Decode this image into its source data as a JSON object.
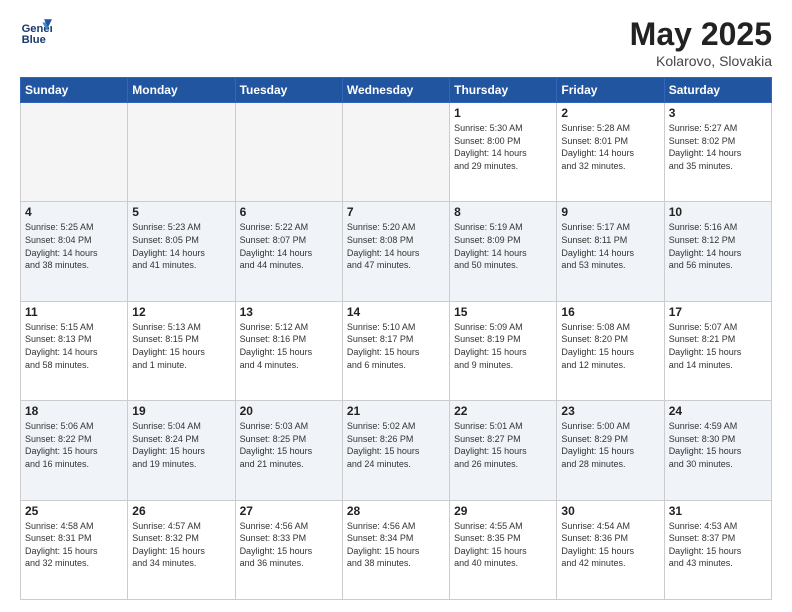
{
  "header": {
    "logo_line1": "General",
    "logo_line2": "Blue",
    "month_year": "May 2025",
    "location": "Kolarovo, Slovakia"
  },
  "weekdays": [
    "Sunday",
    "Monday",
    "Tuesday",
    "Wednesday",
    "Thursday",
    "Friday",
    "Saturday"
  ],
  "weeks": [
    [
      {
        "day": "",
        "info": ""
      },
      {
        "day": "",
        "info": ""
      },
      {
        "day": "",
        "info": ""
      },
      {
        "day": "",
        "info": ""
      },
      {
        "day": "1",
        "info": "Sunrise: 5:30 AM\nSunset: 8:00 PM\nDaylight: 14 hours\nand 29 minutes."
      },
      {
        "day": "2",
        "info": "Sunrise: 5:28 AM\nSunset: 8:01 PM\nDaylight: 14 hours\nand 32 minutes."
      },
      {
        "day": "3",
        "info": "Sunrise: 5:27 AM\nSunset: 8:02 PM\nDaylight: 14 hours\nand 35 minutes."
      }
    ],
    [
      {
        "day": "4",
        "info": "Sunrise: 5:25 AM\nSunset: 8:04 PM\nDaylight: 14 hours\nand 38 minutes."
      },
      {
        "day": "5",
        "info": "Sunrise: 5:23 AM\nSunset: 8:05 PM\nDaylight: 14 hours\nand 41 minutes."
      },
      {
        "day": "6",
        "info": "Sunrise: 5:22 AM\nSunset: 8:07 PM\nDaylight: 14 hours\nand 44 minutes."
      },
      {
        "day": "7",
        "info": "Sunrise: 5:20 AM\nSunset: 8:08 PM\nDaylight: 14 hours\nand 47 minutes."
      },
      {
        "day": "8",
        "info": "Sunrise: 5:19 AM\nSunset: 8:09 PM\nDaylight: 14 hours\nand 50 minutes."
      },
      {
        "day": "9",
        "info": "Sunrise: 5:17 AM\nSunset: 8:11 PM\nDaylight: 14 hours\nand 53 minutes."
      },
      {
        "day": "10",
        "info": "Sunrise: 5:16 AM\nSunset: 8:12 PM\nDaylight: 14 hours\nand 56 minutes."
      }
    ],
    [
      {
        "day": "11",
        "info": "Sunrise: 5:15 AM\nSunset: 8:13 PM\nDaylight: 14 hours\nand 58 minutes."
      },
      {
        "day": "12",
        "info": "Sunrise: 5:13 AM\nSunset: 8:15 PM\nDaylight: 15 hours\nand 1 minute."
      },
      {
        "day": "13",
        "info": "Sunrise: 5:12 AM\nSunset: 8:16 PM\nDaylight: 15 hours\nand 4 minutes."
      },
      {
        "day": "14",
        "info": "Sunrise: 5:10 AM\nSunset: 8:17 PM\nDaylight: 15 hours\nand 6 minutes."
      },
      {
        "day": "15",
        "info": "Sunrise: 5:09 AM\nSunset: 8:19 PM\nDaylight: 15 hours\nand 9 minutes."
      },
      {
        "day": "16",
        "info": "Sunrise: 5:08 AM\nSunset: 8:20 PM\nDaylight: 15 hours\nand 12 minutes."
      },
      {
        "day": "17",
        "info": "Sunrise: 5:07 AM\nSunset: 8:21 PM\nDaylight: 15 hours\nand 14 minutes."
      }
    ],
    [
      {
        "day": "18",
        "info": "Sunrise: 5:06 AM\nSunset: 8:22 PM\nDaylight: 15 hours\nand 16 minutes."
      },
      {
        "day": "19",
        "info": "Sunrise: 5:04 AM\nSunset: 8:24 PM\nDaylight: 15 hours\nand 19 minutes."
      },
      {
        "day": "20",
        "info": "Sunrise: 5:03 AM\nSunset: 8:25 PM\nDaylight: 15 hours\nand 21 minutes."
      },
      {
        "day": "21",
        "info": "Sunrise: 5:02 AM\nSunset: 8:26 PM\nDaylight: 15 hours\nand 24 minutes."
      },
      {
        "day": "22",
        "info": "Sunrise: 5:01 AM\nSunset: 8:27 PM\nDaylight: 15 hours\nand 26 minutes."
      },
      {
        "day": "23",
        "info": "Sunrise: 5:00 AM\nSunset: 8:29 PM\nDaylight: 15 hours\nand 28 minutes."
      },
      {
        "day": "24",
        "info": "Sunrise: 4:59 AM\nSunset: 8:30 PM\nDaylight: 15 hours\nand 30 minutes."
      }
    ],
    [
      {
        "day": "25",
        "info": "Sunrise: 4:58 AM\nSunset: 8:31 PM\nDaylight: 15 hours\nand 32 minutes."
      },
      {
        "day": "26",
        "info": "Sunrise: 4:57 AM\nSunset: 8:32 PM\nDaylight: 15 hours\nand 34 minutes."
      },
      {
        "day": "27",
        "info": "Sunrise: 4:56 AM\nSunset: 8:33 PM\nDaylight: 15 hours\nand 36 minutes."
      },
      {
        "day": "28",
        "info": "Sunrise: 4:56 AM\nSunset: 8:34 PM\nDaylight: 15 hours\nand 38 minutes."
      },
      {
        "day": "29",
        "info": "Sunrise: 4:55 AM\nSunset: 8:35 PM\nDaylight: 15 hours\nand 40 minutes."
      },
      {
        "day": "30",
        "info": "Sunrise: 4:54 AM\nSunset: 8:36 PM\nDaylight: 15 hours\nand 42 minutes."
      },
      {
        "day": "31",
        "info": "Sunrise: 4:53 AM\nSunset: 8:37 PM\nDaylight: 15 hours\nand 43 minutes."
      }
    ]
  ]
}
